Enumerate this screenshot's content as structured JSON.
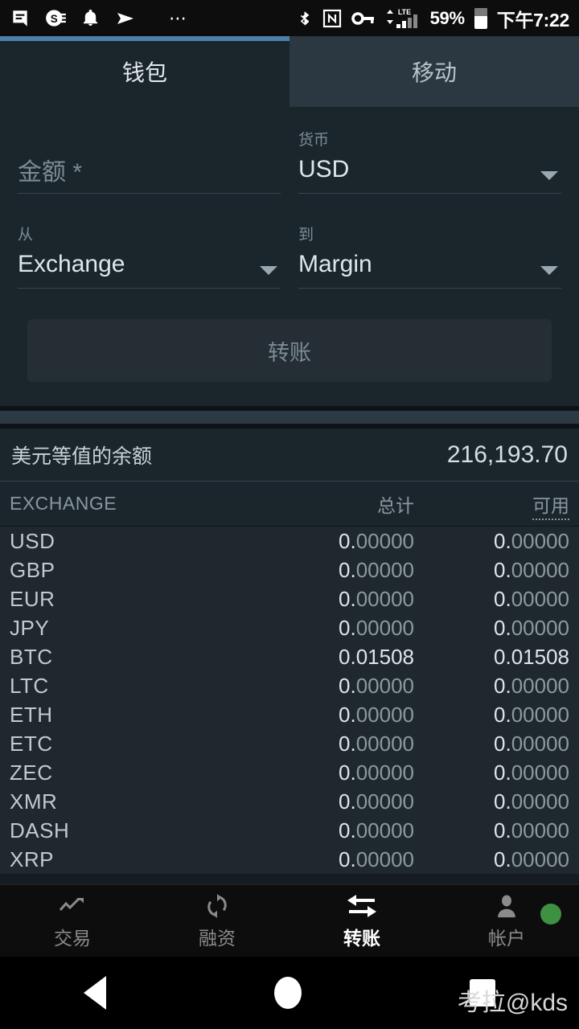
{
  "statusbar": {
    "left_icons": [
      "message-icon",
      "s-app-icon",
      "bell-icon",
      "send-icon",
      "overflow-dots-icon"
    ],
    "overflow": "⋯",
    "right_icons": [
      "bluetooth-icon",
      "nfc-icon",
      "vpn-key-icon",
      "lte-signal-icon"
    ],
    "lte_label": "LTE",
    "battery_percent": "59%",
    "time": "下午7:22"
  },
  "tabs": [
    {
      "label": "钱包",
      "active": true
    },
    {
      "label": "移动",
      "active": false
    }
  ],
  "form": {
    "amount": {
      "label": "",
      "placeholder": "金额 *",
      "value": ""
    },
    "currency": {
      "label": "货币",
      "value": "USD"
    },
    "from": {
      "label": "从",
      "value": "Exchange"
    },
    "to": {
      "label": "到",
      "value": "Margin"
    },
    "submit_label": "转账"
  },
  "balance": {
    "label": "美元等值的余额",
    "value": "216,193.70"
  },
  "table": {
    "headers": {
      "name": "EXCHANGE",
      "total": "总计",
      "available": "可用"
    },
    "rows": [
      {
        "name": "USD",
        "total": "0.00000",
        "available": "0.00000",
        "nonzero": false
      },
      {
        "name": "GBP",
        "total": "0.00000",
        "available": "0.00000",
        "nonzero": false
      },
      {
        "name": "EUR",
        "total": "0.00000",
        "available": "0.00000",
        "nonzero": false
      },
      {
        "name": "JPY",
        "total": "0.00000",
        "available": "0.00000",
        "nonzero": false
      },
      {
        "name": "BTC",
        "total": "0.01508",
        "available": "0.01508",
        "nonzero": true
      },
      {
        "name": "LTC",
        "total": "0.00000",
        "available": "0.00000",
        "nonzero": false
      },
      {
        "name": "ETH",
        "total": "0.00000",
        "available": "0.00000",
        "nonzero": false
      },
      {
        "name": "ETC",
        "total": "0.00000",
        "available": "0.00000",
        "nonzero": false
      },
      {
        "name": "ZEC",
        "total": "0.00000",
        "available": "0.00000",
        "nonzero": false
      },
      {
        "name": "XMR",
        "total": "0.00000",
        "available": "0.00000",
        "nonzero": false
      },
      {
        "name": "DASH",
        "total": "0.00000",
        "available": "0.00000",
        "nonzero": false
      },
      {
        "name": "XRP",
        "total": "0.00000",
        "available": "0.00000",
        "nonzero": false
      }
    ]
  },
  "bottomnav": [
    {
      "label": "交易",
      "icon": "trending-up-icon",
      "active": false
    },
    {
      "label": "融资",
      "icon": "refresh-icon",
      "active": false
    },
    {
      "label": "转账",
      "icon": "transfer-arrows-icon",
      "active": true
    },
    {
      "label": "帐户",
      "icon": "person-icon",
      "active": false,
      "status_dot": "#3f9142"
    }
  ],
  "sysnav": [
    "back-button",
    "home-button",
    "recents-button"
  ],
  "watermark": "考拉@kds",
  "colors": {
    "accent": "#4d80a8",
    "card": "#1b262c",
    "tab_inactive": "#2b3841",
    "status_dot": "#3f9142"
  }
}
